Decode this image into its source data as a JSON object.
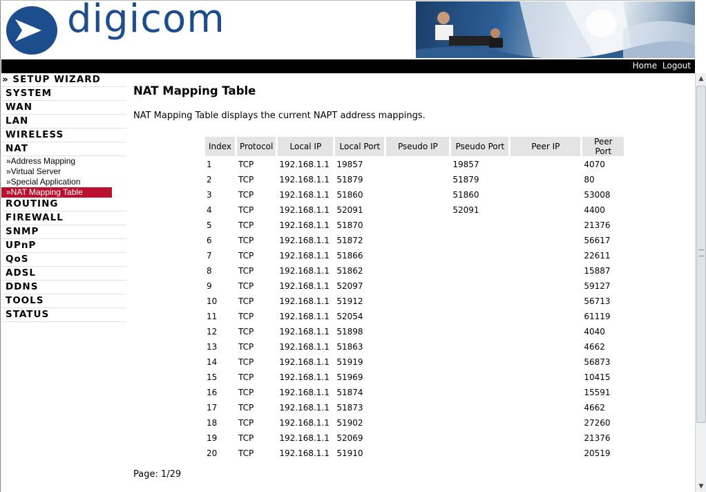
{
  "header": {
    "logo_text": "digicom",
    "nav": {
      "home": "Home",
      "logout": "Logout"
    }
  },
  "sidebar": {
    "setup_wizard": "» SETUP WIZARD",
    "menus_top": [
      "SYSTEM",
      "WAN",
      "LAN",
      "WIRELESS",
      "NAT"
    ],
    "nat_sub": [
      "»Address Mapping",
      "»Virtual Server",
      "»Special Application",
      "»NAT Mapping Table"
    ],
    "menus_bottom": [
      "ROUTING",
      "FIREWALL",
      "SNMP",
      "UPnP",
      "QoS",
      "ADSL",
      "DDNS",
      "TOOLS",
      "STATUS"
    ],
    "active_item": "»NAT Mapping Table"
  },
  "main": {
    "title": "NAT Mapping Table",
    "description": "NAT Mapping Table displays the current NAPT address mappings.",
    "columns": [
      "Index",
      "Protocol",
      "Local IP",
      "Local Port",
      "Pseudo IP",
      "Pseudo Port",
      "Peer IP",
      "Peer Port"
    ],
    "rows": [
      [
        "1",
        "TCP",
        "192.168.1.1",
        "19857",
        "",
        "19857",
        "",
        "4070"
      ],
      [
        "2",
        "TCP",
        "192.168.1.1",
        "51879",
        "",
        "51879",
        "",
        "80"
      ],
      [
        "3",
        "TCP",
        "192.168.1.1",
        "51860",
        "",
        "51860",
        "",
        "53008"
      ],
      [
        "4",
        "TCP",
        "192.168.1.1",
        "52091",
        "",
        "52091",
        "",
        "4400"
      ],
      [
        "5",
        "TCP",
        "192.168.1.1",
        "51870",
        "",
        "",
        "",
        "21376"
      ],
      [
        "6",
        "TCP",
        "192.168.1.1",
        "51872",
        "",
        "",
        "",
        "56617"
      ],
      [
        "7",
        "TCP",
        "192.168.1.1",
        "51866",
        "",
        "",
        "",
        "22611"
      ],
      [
        "8",
        "TCP",
        "192.168.1.1",
        "51862",
        "",
        "",
        "",
        "15887"
      ],
      [
        "9",
        "TCP",
        "192.168.1.1",
        "52097",
        "",
        "",
        "",
        "59127"
      ],
      [
        "10",
        "TCP",
        "192.168.1.1",
        "51912",
        "",
        "",
        "",
        "56713"
      ],
      [
        "11",
        "TCP",
        "192.168.1.1",
        "52054",
        "",
        "",
        "",
        "61119"
      ],
      [
        "12",
        "TCP",
        "192.168.1.1",
        "51898",
        "",
        "",
        "",
        "4040"
      ],
      [
        "13",
        "TCP",
        "192.168.1.1",
        "51863",
        "",
        "",
        "",
        "4662"
      ],
      [
        "14",
        "TCP",
        "192.168.1.1",
        "51919",
        "",
        "",
        "",
        "56873"
      ],
      [
        "15",
        "TCP",
        "192.168.1.1",
        "51969",
        "",
        "",
        "",
        "10415"
      ],
      [
        "16",
        "TCP",
        "192.168.1.1",
        "51874",
        "",
        "",
        "",
        "15591"
      ],
      [
        "17",
        "TCP",
        "192.168.1.1",
        "51873",
        "",
        "",
        "",
        "4662"
      ],
      [
        "18",
        "TCP",
        "192.168.1.1",
        "51902",
        "",
        "",
        "",
        "27260"
      ],
      [
        "19",
        "TCP",
        "192.168.1.1",
        "52069",
        "",
        "",
        "",
        "21376"
      ],
      [
        "20",
        "TCP",
        "192.168.1.1",
        "51910",
        "",
        "",
        "",
        "20519"
      ]
    ],
    "page_info": "Page: 1/29"
  },
  "icons": {
    "scroll_up": "arrow-up-icon",
    "scroll_down": "arrow-down-icon",
    "logo": "digicom-arrow-logo-icon"
  },
  "colors": {
    "brand_blue": "#1c4d8c",
    "active_menu": "#b8102e",
    "header_bar": "#000000",
    "table_header": "#e4e4e4"
  }
}
